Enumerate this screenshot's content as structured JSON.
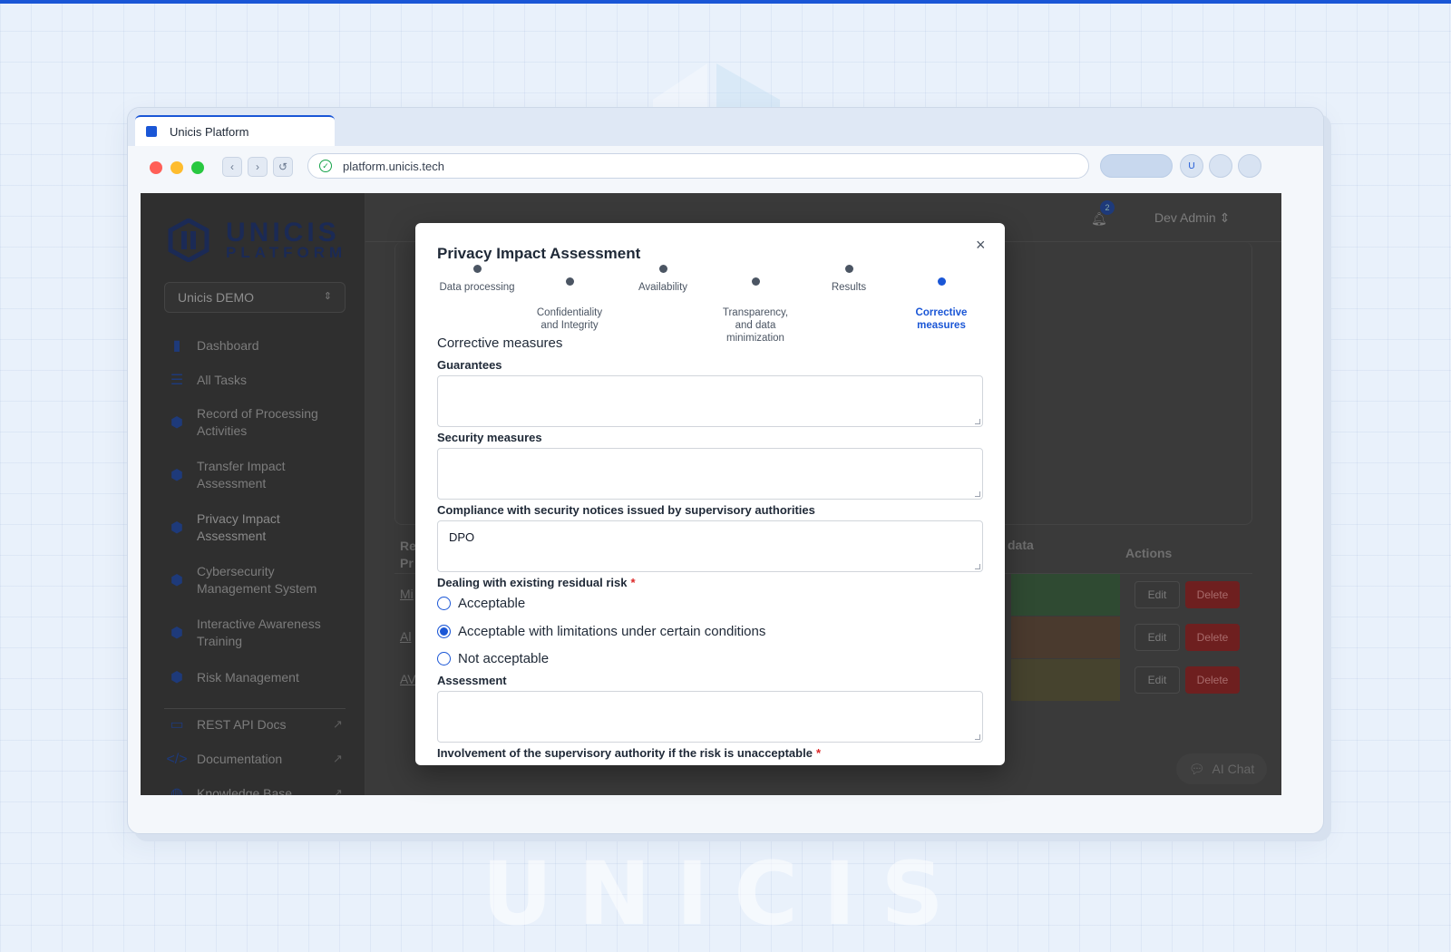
{
  "browser": {
    "tab_title": "Unicis Platform",
    "url": "platform.unicis.tech",
    "profile_initial": "U"
  },
  "watermark": "UNICIS",
  "sidebar": {
    "brand_line1": "UNICIS",
    "brand_line2": "PLATFORM",
    "org": "Unicis DEMO",
    "items": [
      {
        "label": "Dashboard",
        "icon": "bar-chart-icon"
      },
      {
        "label": "All Tasks",
        "icon": "list-icon"
      },
      {
        "label": "Record of Processing\nActivities",
        "icon": "ropa-icon"
      },
      {
        "label": "Transfer Impact\nAssessment",
        "icon": "transfer-icon"
      },
      {
        "label": "Privacy Impact\nAssessment",
        "icon": "privacy-icon"
      },
      {
        "label": "Cybersecurity\nManagement System",
        "icon": "shield-icon"
      },
      {
        "label": "Interactive Awareness\nTraining",
        "icon": "training-icon"
      },
      {
        "label": "Risk Management",
        "icon": "risk-icon"
      }
    ],
    "links": [
      {
        "label": "REST API Docs",
        "icon": "document-icon"
      },
      {
        "label": "Documentation",
        "icon": "code-icon"
      },
      {
        "label": "Knowledge Base",
        "icon": "globe-icon"
      }
    ]
  },
  "header": {
    "notification_count": "2",
    "user_name": "Dev Admin"
  },
  "background_table": {
    "col_first": "Re\nPr",
    "col_data": "data",
    "col_actions": "Actions",
    "rows": [
      {
        "link": "Mi",
        "color": "#2f4a32"
      },
      {
        "link": "Al",
        "color": "#4a3a2e"
      },
      {
        "link": "AV",
        "color": "#46432e"
      }
    ],
    "edit_label": "Edit",
    "delete_label": "Delete"
  },
  "ai_chat_label": "AI Chat",
  "modal": {
    "title": "Privacy Impact Assessment",
    "close_glyph": "×",
    "steps": [
      {
        "label": "Data processing",
        "active": false
      },
      {
        "label": "Confidentiality\nand Integrity",
        "active": false
      },
      {
        "label": "Availability",
        "active": false
      },
      {
        "label": "Transparency,\nand data\nminimization",
        "active": false
      },
      {
        "label": "Results",
        "active": false
      },
      {
        "label": "Corrective\nmeasures",
        "active": true
      }
    ],
    "section_title": "Corrective measures",
    "fields": {
      "guarantees_label": "Guarantees",
      "guarantees_value": "",
      "security_label": "Security measures",
      "security_value": "",
      "compliance_label": "Compliance with security notices issued by supervisory authorities",
      "compliance_value": "DPO",
      "residual_label": "Dealing with existing residual risk",
      "residual_options": [
        "Acceptable",
        "Acceptable with limitations under certain conditions",
        "Not acceptable"
      ],
      "residual_selected": "Acceptable with limitations under certain conditions",
      "assessment_label": "Assessment",
      "assessment_value": "",
      "involvement_label": "Involvement of the supervisory authority if the risk is unacceptable",
      "required_mark": "*"
    }
  },
  "colors": {
    "accent": "#1a56d6",
    "required": "#dc2626",
    "delete_button": "#6e1f1f"
  }
}
